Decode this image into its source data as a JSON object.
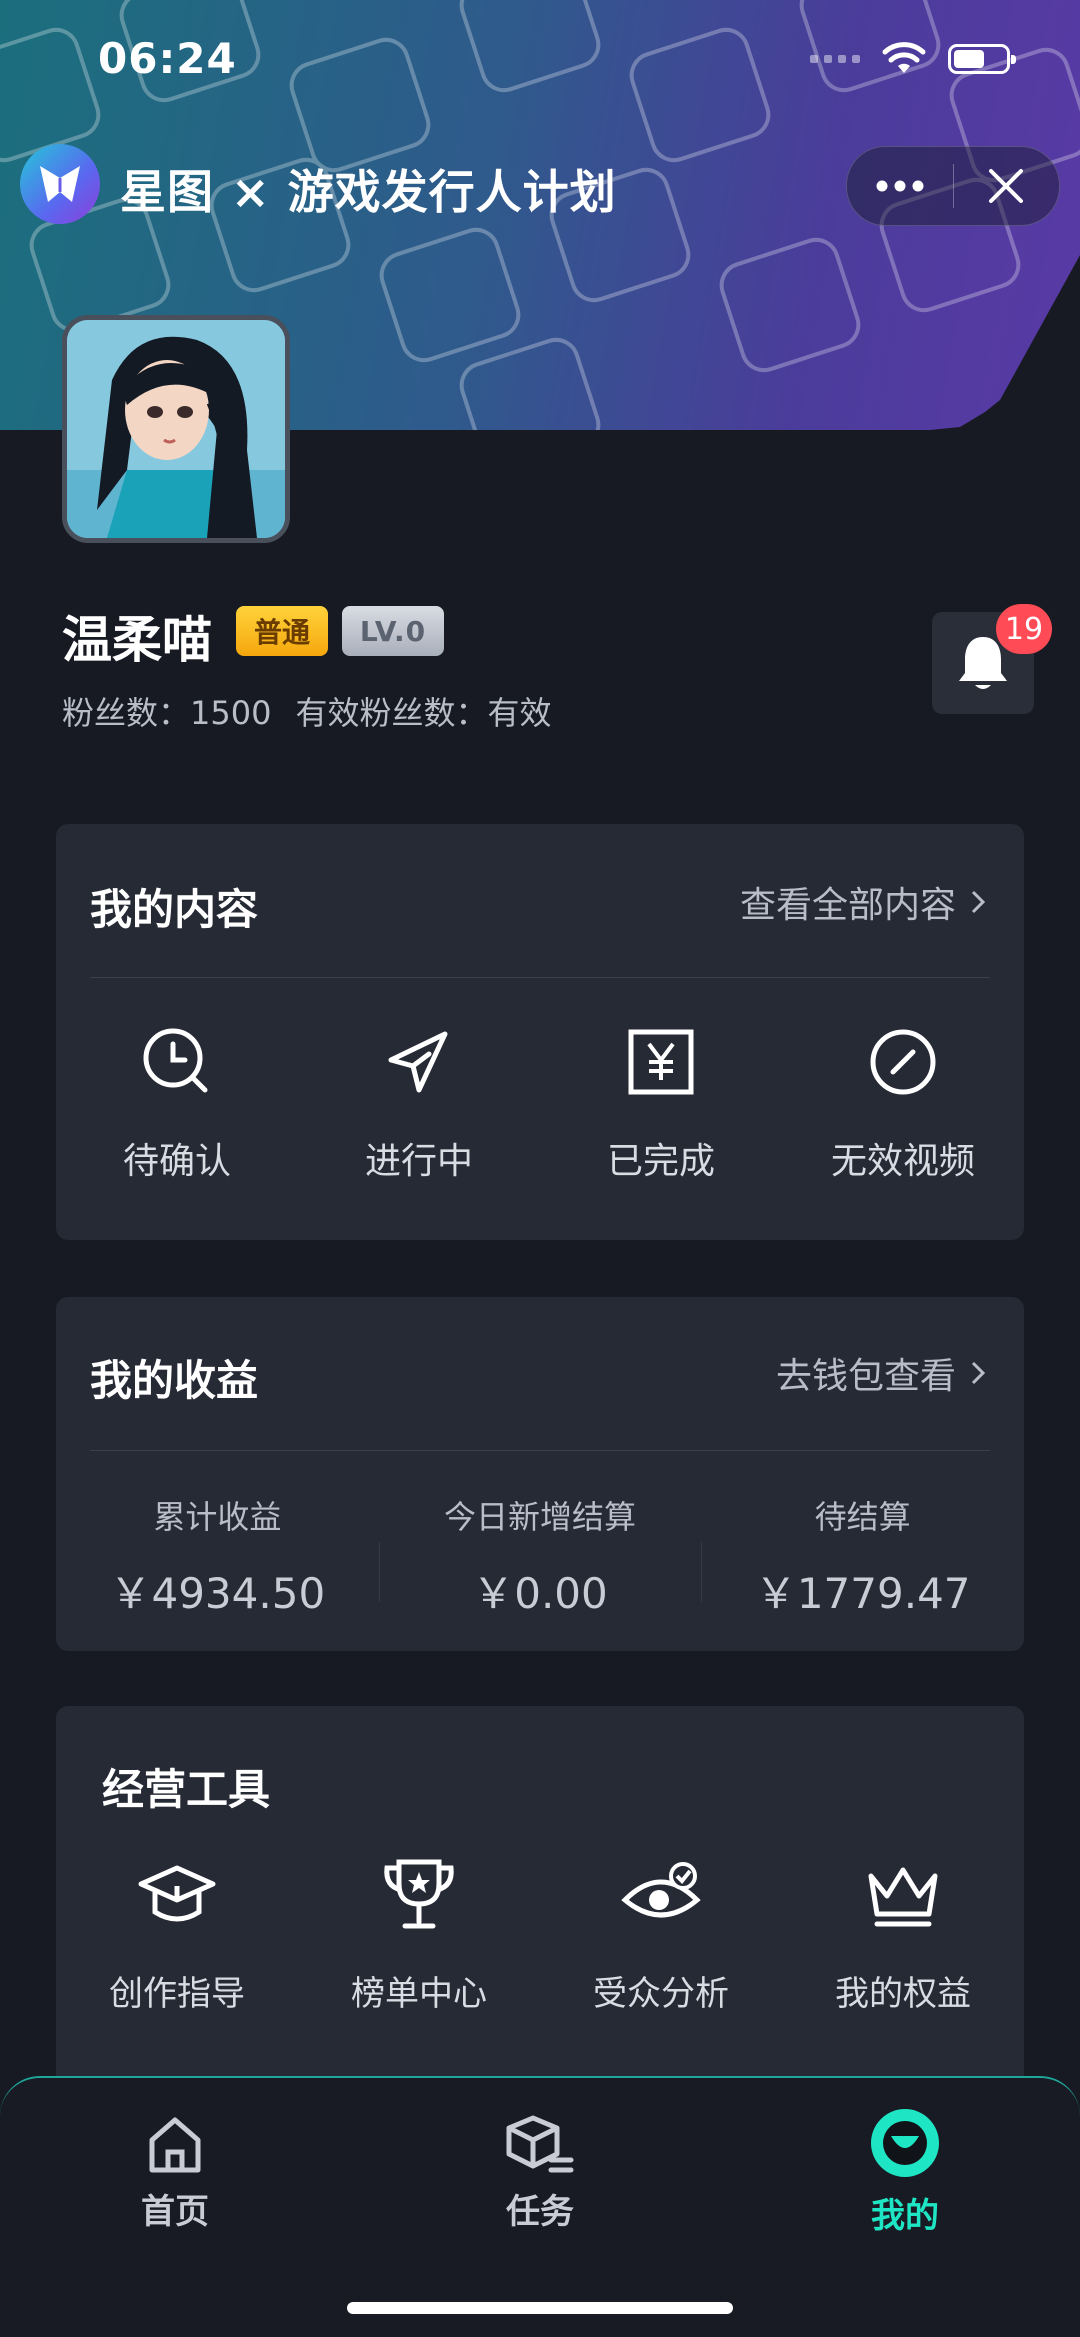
{
  "status_bar": {
    "time": "06:24",
    "icons": [
      "signal-dots-icon",
      "wifi-icon",
      "battery-icon"
    ]
  },
  "title_bar": {
    "title": "星图 × 游戏发行人计划",
    "more_icon": "more-dots-icon",
    "close_icon": "close-icon"
  },
  "profile": {
    "name": "温柔喵",
    "badge_level_type": "普通",
    "badge_level": "LV.0",
    "fans_text": "粉丝数：1500",
    "valid_fans_text": "有效粉丝数：有效",
    "notification_count": "19"
  },
  "my_content": {
    "title": "我的内容",
    "link": "查看全部内容",
    "items": [
      {
        "label": "待确认",
        "icon": "clock-search-icon"
      },
      {
        "label": "进行中",
        "icon": "paper-plane-icon"
      },
      {
        "label": "已完成",
        "icon": "yen-box-icon"
      },
      {
        "label": "无效视频",
        "icon": "prohibited-icon"
      }
    ]
  },
  "my_earnings": {
    "title": "我的收益",
    "link": "去钱包查看",
    "items": [
      {
        "label": "累计收益",
        "value": "￥4934.50"
      },
      {
        "label": "今日新增结算",
        "value": "￥0.00"
      },
      {
        "label": "待结算",
        "value": "￥1779.47"
      }
    ]
  },
  "tools": {
    "title": "经营工具",
    "items": [
      {
        "label": "创作指导",
        "icon": "graduation-cap-icon"
      },
      {
        "label": "榜单中心",
        "icon": "trophy-icon"
      },
      {
        "label": "受众分析",
        "icon": "eye-check-icon"
      },
      {
        "label": "我的权益",
        "icon": "crown-icon"
      }
    ]
  },
  "tab_bar": {
    "items": [
      {
        "label": "首页",
        "icon": "home-icon"
      },
      {
        "label": "任务",
        "icon": "box-list-icon"
      },
      {
        "label": "我的",
        "icon": "smile-face-icon",
        "active": true
      }
    ]
  },
  "colors": {
    "accent": "#1ee6c4",
    "card": "#262a35",
    "background": "#171a22",
    "badge": "#ff4b55"
  }
}
